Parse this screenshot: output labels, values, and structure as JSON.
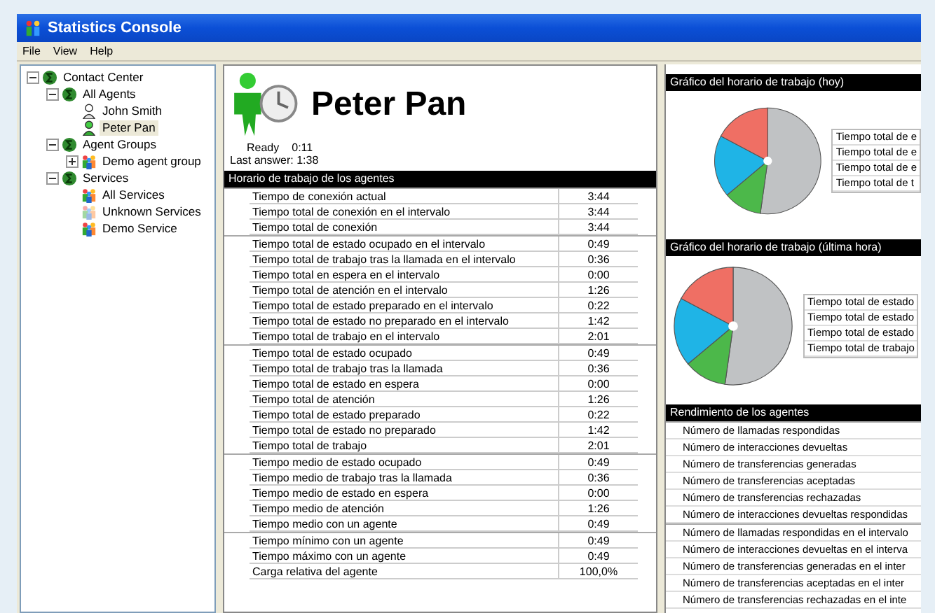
{
  "window": {
    "title": "Statistics Console"
  },
  "menu": [
    "File",
    "View",
    "Help"
  ],
  "tree": [
    {
      "label": "Contact Center",
      "kind": "sigma",
      "expanded": true,
      "selected": false,
      "children": [
        {
          "label": "All Agents",
          "kind": "sigma",
          "expanded": true,
          "selected": false,
          "children": [
            {
              "label": "John Smith",
              "kind": "agent-off",
              "selected": false
            },
            {
              "label": "Peter Pan",
              "kind": "agent-ready",
              "selected": true
            }
          ]
        },
        {
          "label": "Agent Groups",
          "kind": "sigma",
          "expanded": true,
          "selected": false,
          "children": [
            {
              "label": "Demo agent group",
              "kind": "group",
              "expanded": false,
              "selected": false
            }
          ]
        },
        {
          "label": "Services",
          "kind": "sigma",
          "expanded": true,
          "selected": false,
          "children": [
            {
              "label": "All Services",
              "kind": "group",
              "selected": false
            },
            {
              "label": "Unknown Services",
              "kind": "group-grey",
              "selected": false
            },
            {
              "label": "Demo Service",
              "kind": "group",
              "selected": false
            }
          ]
        }
      ]
    }
  ],
  "agent": {
    "name": "Peter Pan",
    "state": "Ready",
    "state_time": "0:11",
    "last_answer": "Last answer: 1:38"
  },
  "schedule": {
    "title": "Horario de trabajo de los agentes",
    "groups": [
      [
        [
          "Tiempo de conexión actual",
          "3:44"
        ],
        [
          "Tiempo total de conexión en el intervalo",
          "3:44"
        ],
        [
          "Tiempo total de conexión",
          "3:44"
        ]
      ],
      [
        [
          "Tiempo total de estado ocupado en el intervalo",
          "0:49"
        ],
        [
          "Tiempo total de trabajo tras la llamada en el intervalo",
          "0:36"
        ],
        [
          "Tiempo total en espera en el intervalo",
          "0:00"
        ],
        [
          "Tiempo total de atención en el intervalo",
          "1:26"
        ],
        [
          "Tiempo total de estado preparado en el intervalo",
          "0:22"
        ],
        [
          "Tiempo total de estado no preparado en el intervalo",
          "1:42"
        ],
        [
          "Tiempo total de trabajo en el intervalo",
          "2:01"
        ]
      ],
      [
        [
          "Tiempo total de estado ocupado",
          "0:49"
        ],
        [
          "Tiempo total de trabajo tras la llamada",
          "0:36"
        ],
        [
          "Tiempo total de estado en espera",
          "0:00"
        ],
        [
          "Tiempo total de atención",
          "1:26"
        ],
        [
          "Tiempo total de estado preparado",
          "0:22"
        ],
        [
          "Tiempo total de estado no preparado",
          "1:42"
        ],
        [
          "Tiempo total de trabajo",
          "2:01"
        ]
      ],
      [
        [
          "Tiempo medio de estado ocupado",
          "0:49"
        ],
        [
          "Tiempo medio de trabajo tras la llamada",
          "0:36"
        ],
        [
          "Tiempo medio de estado en espera",
          "0:00"
        ],
        [
          "Tiempo medio de atención",
          "1:26"
        ],
        [
          "Tiempo medio con un agente",
          "0:49"
        ]
      ],
      [
        [
          "Tiempo mínimo con un agente",
          "0:49"
        ],
        [
          "Tiempo máximo con un agente",
          "0:49"
        ],
        [
          "Carga relativa del agente",
          "100,0%"
        ]
      ]
    ]
  },
  "charts": [
    {
      "title": "Gráfico del horario de trabajo (hoy)",
      "legend": [
        "Tiempo total de e",
        "Tiempo total de e",
        "Tiempo total de e",
        "Tiempo total de t"
      ]
    },
    {
      "title": "Gráfico del horario de trabajo (última hora)",
      "legend": [
        "Tiempo total de estado",
        "Tiempo total de estado",
        "Tiempo total de estado",
        "Tiempo total de trabajo"
      ]
    }
  ],
  "performance": {
    "title": "Rendimiento de los agentes",
    "groups": [
      [
        "Número de llamadas respondidas",
        "Número de interacciones devueltas",
        "Número de transferencias generadas",
        "Número de transferencias aceptadas",
        "Número de transferencias rechazadas",
        "Número de interacciones devueltas respondidas"
      ],
      [
        "Número de llamadas respondidas en el intervalo",
        "Número de interacciones devueltas en el interva",
        "Número de transferencias generadas en el inter",
        "Número de transferencias aceptadas en el inter",
        "Número de transferencias rechazadas en el inte"
      ]
    ]
  }
}
